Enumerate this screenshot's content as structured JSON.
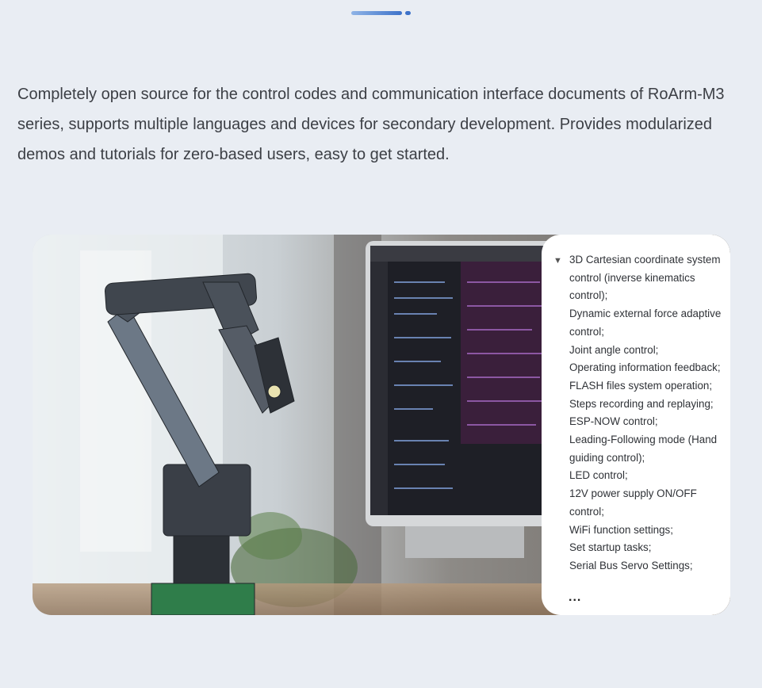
{
  "intro_text": "Completely open source for the control codes and communication interface documents of RoArm-M3 series, supports multiple languages and devices for secondary development. Provides modularized demos and tutorials for zero-based users, easy to get started.",
  "features": [
    "3D Cartesian coordinate system control (inverse kinematics control);",
    "Dynamic external force adaptive control;",
    "Joint angle control;",
    "Operating information feedback;",
    "FLASH files system operation;",
    "Steps recording and replaying;",
    "ESP-NOW control;",
    "Leading-Following mode (Hand guiding control);",
    "LED control;",
    "12V power supply ON/OFF control;",
    "WiFi function settings;",
    "Set startup tasks;",
    "Serial Bus Servo Settings;"
  ],
  "more_label": "...",
  "colors": {
    "background": "#e9edf3",
    "accent": "#3d72c9",
    "text": "#3c3f45"
  }
}
